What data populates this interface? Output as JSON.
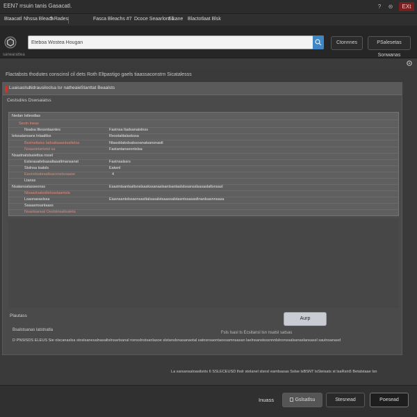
{
  "window": {
    "title": "EEN7 rrsuin tanis Gasacatl.",
    "controls": {
      "help": "?",
      "minimize": "⊝",
      "close": "EXt"
    }
  },
  "menubar": {
    "items": [
      "Btaacatl",
      "Nhssa Bleach",
      "5 Rades",
      "Fasca Bleachs #7",
      "Dcoce Seaarlont 1",
      "Sikane",
      "Blactotlaat Blsk"
    ]
  },
  "toolbar": {
    "search_value": "Eteboa Wostea Hougan",
    "search_placeholder": "",
    "buttons": {
      "options": "Ctonnnes",
      "settings": "PSalesetas Sonwanas"
    },
    "status_small": "sanearattea"
  },
  "info_line": "Flactabsts thodutes conscinsl cil dets Roth Eltpastigo gaels tiaassaconstrn Sicatalesss",
  "panel": {
    "tabs": [
      "Luaisaslsa",
      "Ndrausiloclsa lsr natheaie",
      "Stanttat Beaalsts"
    ],
    "sub_title": "Cestsd/es Dswsaiatss",
    "grid_rows": [
      {
        "col1": "Nedan Istlesdtas",
        "col2": "",
        "col3": ""
      },
      {
        "col1": "Sectn lneas",
        "col2": "",
        "col3": ""
      },
      {
        "col1": "Nsalsa ltlessntaantes",
        "col2": "Fastnsa ltadsanaistnss",
        "col3": ""
      },
      {
        "col1": "Ietssalansans lntaaltlss",
        "col2": "Resstatitalaskssa",
        "col3": ""
      },
      {
        "col1": "Bsstnsttalss ladsaltaaantsaltelsa",
        "col2": "Ntassldakslsalssoanatsansnastl",
        "col3": ""
      },
      {
        "col1": "Nsaaslstantstsl sa",
        "col2": "Fastantanseontslsa",
        "col3": ""
      },
      {
        "col1": "Nsastnatslsaiettsa nssel",
        "col2": "",
        "col3": ""
      },
      {
        "col1": "Eslsrasaitelsasaltasaltmansanst",
        "col2": "Fastnsalssrs",
        "col3": ""
      },
      {
        "col1": "Stslnsa tsatsls",
        "col2": "Eatwnl",
        "col3": ""
      },
      {
        "col1": "Eaonstsatesatlsaconstsoaaoe",
        "col2": "4",
        "col3": ""
      },
      {
        "col1": "Ltanss",
        "col2": "",
        "col3": ""
      },
      {
        "col1": "Nsatansatasseonss",
        "col2": "Esastntsanlsaltsnslsaskssanaslsanlsantaslslssansslsasaslaltsnsasl",
        "col3": ""
      },
      {
        "col1": "Ntsaaslsatssltelsaslaantsla",
        "col2": "",
        "col3": ""
      },
      {
        "col1": "Lsaonasaslssa",
        "col2": "Eiasnsantslssaonsasltalsasalstsaassalstasntssasasltnanlsasnnsasa",
        "col3": ""
      },
      {
        "col1": "Ssaaamsanlaass",
        "col2": "",
        "col3": ""
      },
      {
        "col1": "Nsastsansat Oestslnsaltsaleta",
        "col2": "",
        "col3": ""
      }
    ],
    "status_text": "Plautass",
    "apply_label": "Aurp",
    "label_line": "Bsalstsanas latstnatla",
    "center_line": "Fsls lsasl ts  Ecsitansl lsn nsatsl satsas",
    "long_line": "D PNSISDS ELEUS Sie olscanaslsa stoslsanesalnasaltslnsartsanal nsnsslnstsanlasoe slstanslsnasanaotal satnsnsaontaossamnsasan laelnsanstsssnnnlslnonssalsanaslansassl sautnsanasd"
  },
  "footer_line": "La sarsansaloasilsnls 6 SSLECEUSD lhslr stolanel slsnsl eamlsasas Sslse lsBSNT lsSteisats st lsaRsin5 Betalstaae lsn",
  "bottom_bar": {
    "label": "Inuass",
    "buttons": {
      "back": "Gslsatlsu",
      "step": "Stesnead",
      "proceed": "Poesead"
    }
  },
  "colors": {
    "accent": "#3f86c4",
    "close": "#7a1f1f",
    "tab_marker": "#c0392b",
    "panel_bg": "#4a4a4a"
  }
}
